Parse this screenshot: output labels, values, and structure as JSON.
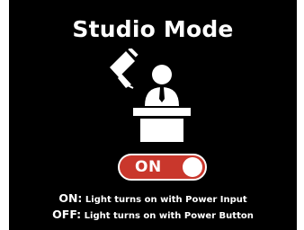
{
  "screen": {
    "title": "Studio Mode",
    "illustration_icon": "studio-presenter-with-light-icon",
    "toggle": {
      "label": "ON",
      "state": "on",
      "color": "#c9372c"
    },
    "descriptions": {
      "on_key": "ON:",
      "on_text": "Light turns on with Power Input",
      "off_key": "OFF:",
      "off_text": "Light turns on with Power Button"
    }
  }
}
